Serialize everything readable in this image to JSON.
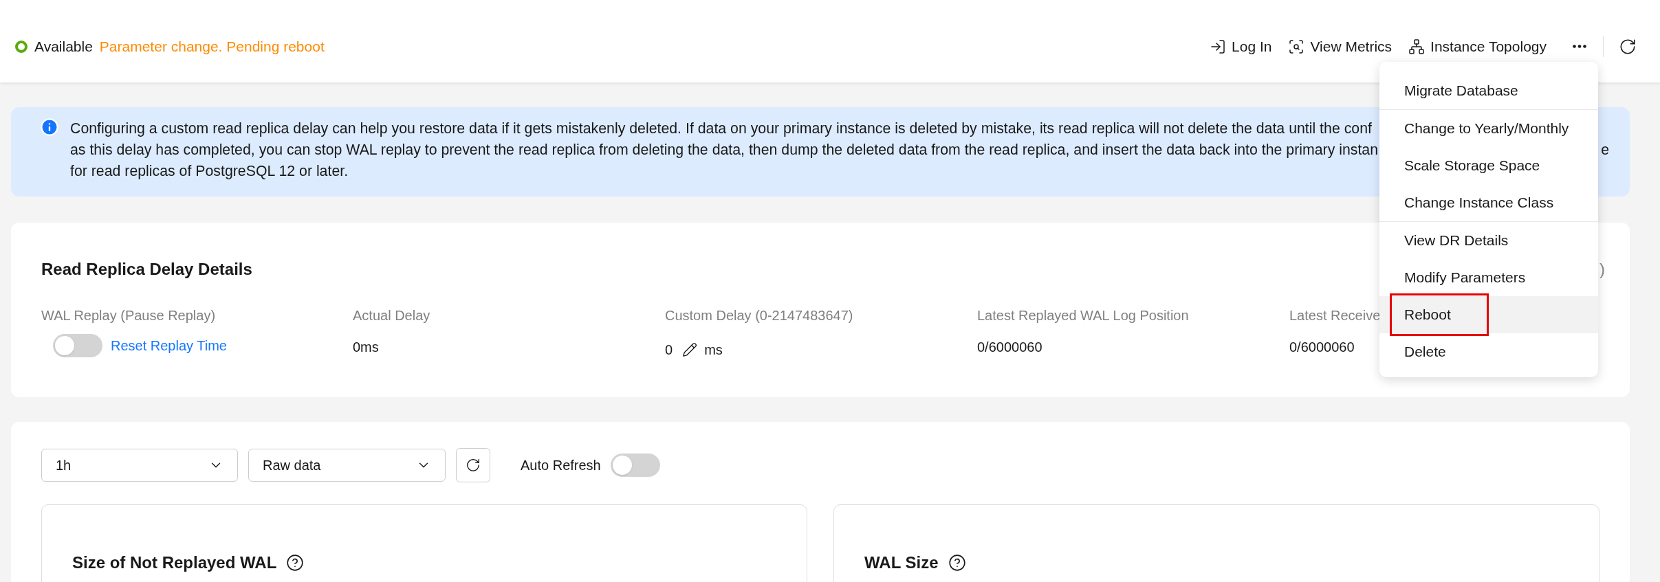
{
  "status": {
    "label": "Available",
    "color": "#5aab0a",
    "note": "Parameter change. Pending reboot"
  },
  "actions": [
    {
      "kind": "login",
      "label": "Log In"
    },
    {
      "kind": "metrics",
      "label": "View Metrics"
    },
    {
      "kind": "topology",
      "label": "Instance Topology"
    }
  ],
  "banner": {
    "lines": [
      "Configuring a custom read replica delay can help you restore data if it gets mistakenly deleted. If data on your primary instance is deleted by mistake, its read replica will not delete the data until the conf",
      "as this delay has completed, you can stop WAL replay to prevent the read replica from deleting the data, then dump the deleted data from the read replica, and insert the data back into the primary instan",
      "for read replicas of PostgreSQL 12 or later."
    ],
    "line_2_tail": "e"
  },
  "delay_card": {
    "title": "Read Replica Delay Details",
    "title_fragment": ")",
    "columns": [
      {
        "kind": "toggle",
        "label": "WAL Replay (Pause Replay)",
        "on": false,
        "link": "Reset Replay Time"
      },
      {
        "kind": "text",
        "label": "Actual Delay",
        "value": "0ms"
      },
      {
        "kind": "edit",
        "label": "Custom Delay (0-2147483647)",
        "value": "0",
        "unit": "ms"
      },
      {
        "kind": "text",
        "label": "Latest Replayed WAL Log Position",
        "value": "0/6000060"
      },
      {
        "kind": "text",
        "label": "Latest Receive",
        "value": "0/6000060"
      }
    ]
  },
  "monitor": {
    "range": "1h",
    "mode": "Raw data",
    "auto_refresh": {
      "label": "Auto Refresh",
      "on": false
    },
    "panels": [
      {
        "title": "Size of Not Replayed WAL"
      },
      {
        "title": "WAL Size"
      }
    ]
  },
  "menu": {
    "groups": [
      [
        {
          "label": "Migrate Database",
          "highlighted": false
        }
      ],
      [
        {
          "label": "Change to Yearly/Monthly",
          "highlighted": false
        },
        {
          "label": "Scale Storage Space",
          "highlighted": false
        },
        {
          "label": "Change Instance Class",
          "highlighted": false
        }
      ],
      [
        {
          "label": "View DR Details",
          "highlighted": false
        },
        {
          "label": "Modify Parameters",
          "highlighted": false
        },
        {
          "label": "Reboot",
          "highlighted": true
        },
        {
          "label": "Delete",
          "highlighted": false
        }
      ]
    ]
  }
}
